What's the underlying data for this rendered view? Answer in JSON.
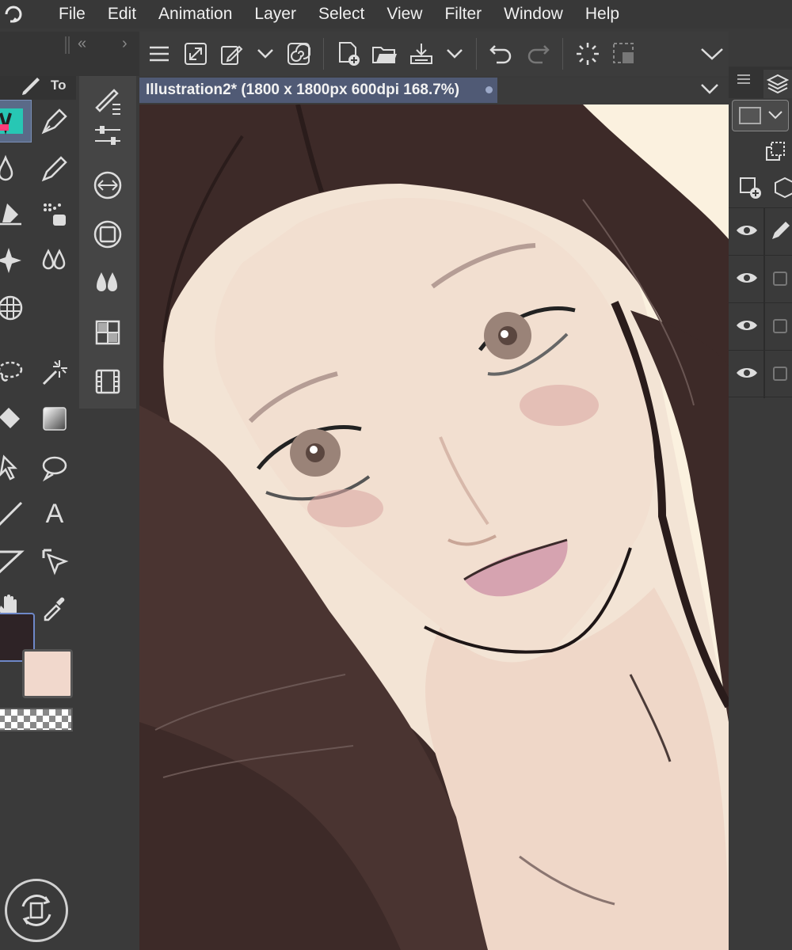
{
  "menubar": {
    "logo_icon": "clip-studio-logo-icon",
    "items": [
      {
        "label": "File"
      },
      {
        "label": "Edit"
      },
      {
        "label": "Animation"
      },
      {
        "label": "Layer"
      },
      {
        "label": "Select"
      },
      {
        "label": "View"
      },
      {
        "label": "Filter"
      },
      {
        "label": "Window"
      },
      {
        "label": "Help"
      }
    ]
  },
  "command_bar": {
    "icons": [
      "hamburger-menu-icon",
      "resize-icon",
      "edit-transform-icon",
      "dropdown-icon",
      "spiral-icon",
      "new-canvas-icon",
      "open-folder-icon",
      "save-icon",
      "dropdown-icon",
      "undo-icon",
      "redo-icon",
      "loading-icon",
      "selection-icon",
      "collapse-icon"
    ]
  },
  "tool_panel": {
    "tab_label": "To",
    "tools": [
      "tool-set-icon",
      "pen-icon",
      "blend-icon",
      "pencil-icon",
      "eraser-icon",
      "airbrush-icon",
      "sparkle-icon",
      "water-drops-icon",
      "3d-figure-icon",
      "lasso-icon",
      "magic-wand-icon",
      "fill-bucket-icon",
      "gradient-icon",
      "move-icon",
      "speech-balloon-icon",
      "line-icon",
      "text-icon",
      "ruler-icon",
      "operation-icon",
      "hand-icon",
      "eyedropper-icon"
    ]
  },
  "colors": {
    "main_color": "#2e2326",
    "sub_color": "#f1d8cc"
  },
  "sub_tools": [
    "brush-settings-icon",
    "adjust-sliders-icon",
    "navigator-icon",
    "square-circle-icon",
    "blend-drops-icon",
    "color-set-icon",
    "animation-timeline-icon"
  ],
  "canvas": {
    "title": "Illustration2* (1800 x 1800px 600dpi 168.7%)"
  },
  "layers": {
    "rows": [
      {
        "visible": true,
        "icon": "pen-icon"
      },
      {
        "visible": true,
        "icon": "checkbox"
      },
      {
        "visible": true,
        "icon": "checkbox"
      },
      {
        "visible": true,
        "icon": "checkbox"
      }
    ]
  }
}
